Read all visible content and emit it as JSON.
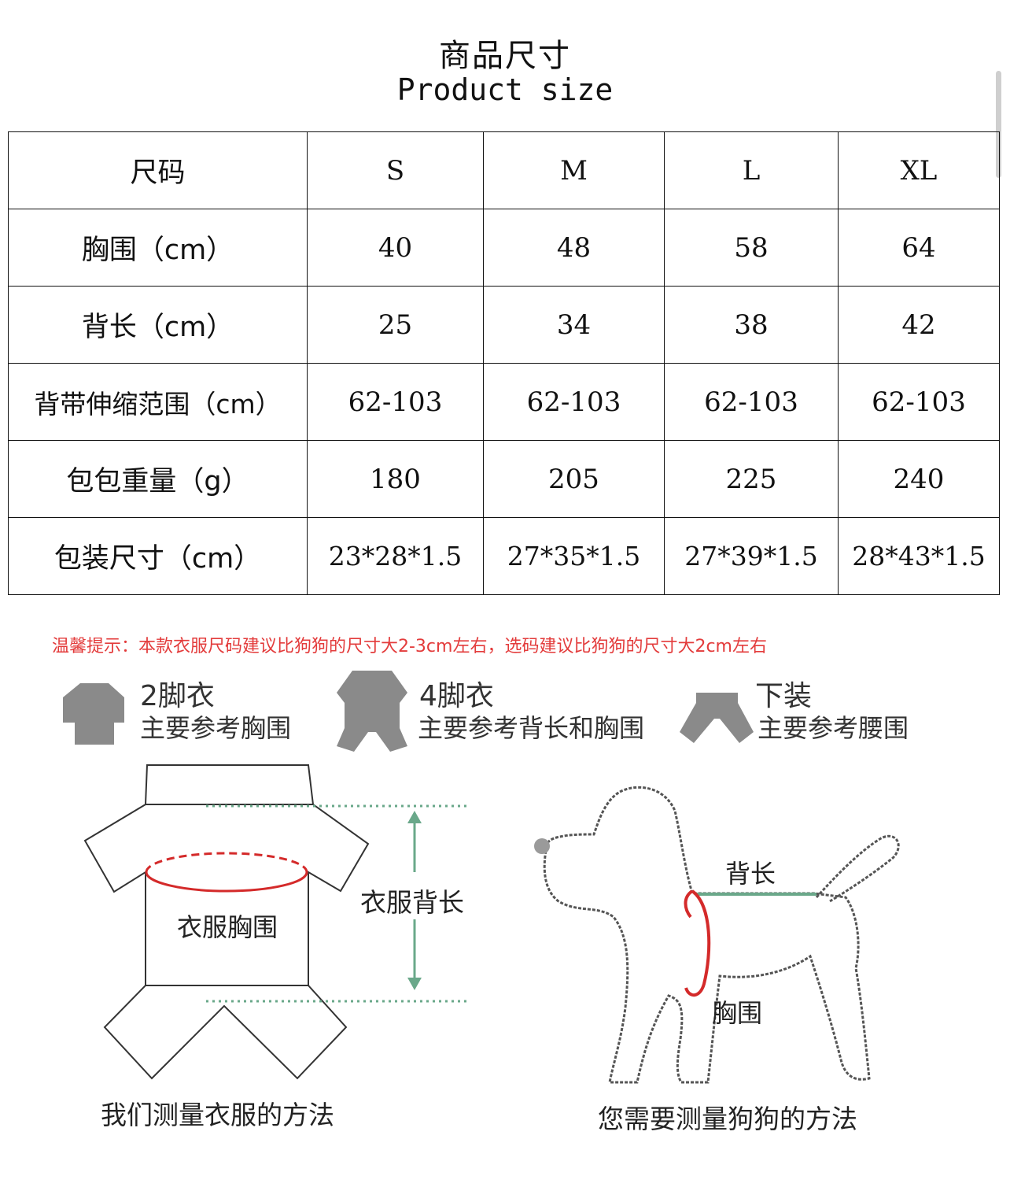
{
  "title_cn": "商品尺寸",
  "title_en": "Product size",
  "table": {
    "header": [
      "尺码",
      "S",
      "M",
      "L",
      "XL"
    ],
    "rows": [
      [
        "胸围（cm）",
        "40",
        "48",
        "58",
        "64"
      ],
      [
        "背长（cm）",
        "25",
        "34",
        "38",
        "42"
      ],
      [
        "背带伸缩范围（cm）",
        "62-103",
        "62-103",
        "62-103",
        "62-103"
      ],
      [
        "包包重量（g）",
        "180",
        "205",
        "225",
        "240"
      ],
      [
        "包装尺寸（cm）",
        "23*28*1.5",
        "27*35*1.5",
        "27*39*1.5",
        "28*43*1.5"
      ]
    ]
  },
  "tip": "温馨提示：本款衣服尺码建议比狗狗的尺寸大2-3cm左右，选码建议比狗狗的尺寸大2cm左右",
  "legend": [
    {
      "name": "2脚衣",
      "ref": "主要参考胸围",
      "icon": "two-leg-shirt-icon"
    },
    {
      "name": "4脚衣",
      "ref": "主要参考背长和胸围",
      "icon": "four-leg-suit-icon"
    },
    {
      "name": "下装",
      "ref": "主要参考腰围",
      "icon": "pants-icon"
    }
  ],
  "diagram_clothes": {
    "chest_label": "衣服胸围",
    "back_label": "衣服背长",
    "caption": "我们测量衣服的方法"
  },
  "diagram_dog": {
    "back_label": "背长",
    "chest_label": "胸围",
    "caption": "您需要测量狗狗的方法"
  },
  "colors": {
    "tip_red": "#e33b3b",
    "chest_red": "#d42a2a",
    "measure_green": "#6aa88a",
    "icon_gray": "#8a8a8a"
  }
}
